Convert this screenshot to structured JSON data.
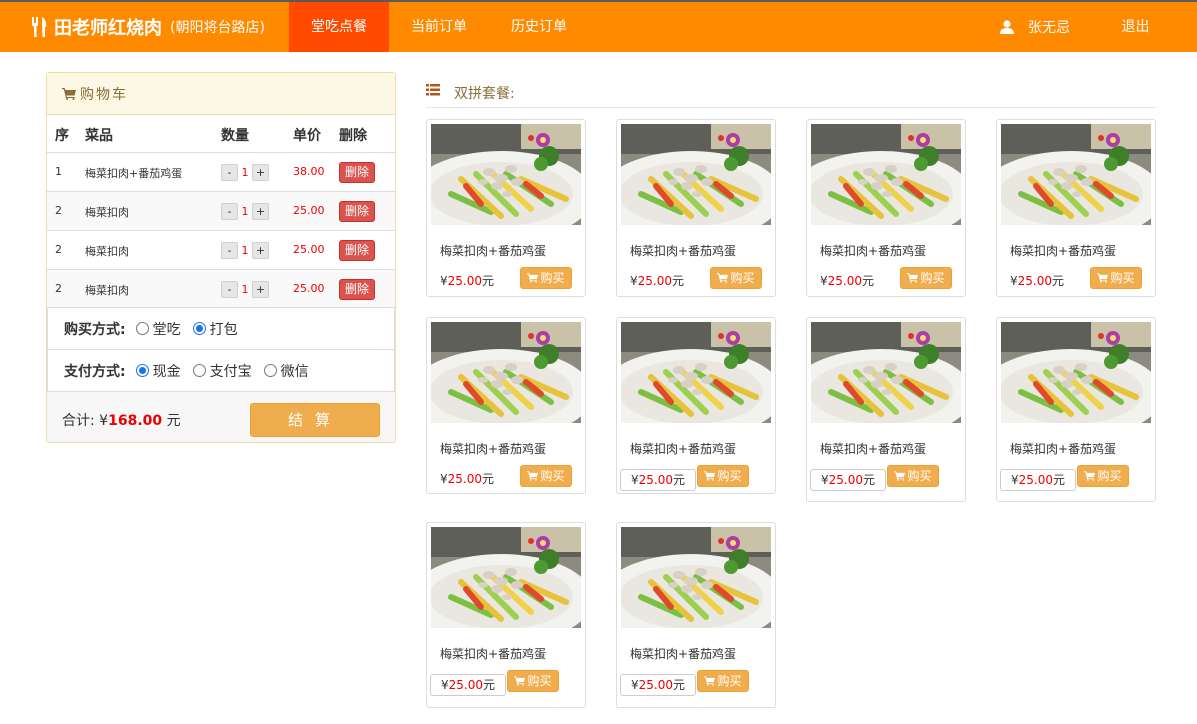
{
  "nav": {
    "brand_name": "田老师红烧肉",
    "brand_branch": "(朝阳将台路店)",
    "items": [
      "堂吃点餐",
      "当前订单",
      "历史订单"
    ],
    "user_name": "张无忌",
    "logout": "退出",
    "accent_color": "#ff8a00",
    "active_color": "#ff4a00"
  },
  "cart": {
    "title": "购物车",
    "headers": [
      "序",
      "菜品",
      "数量",
      "单价",
      "删除"
    ],
    "rows": [
      {
        "seq": "1",
        "name": "梅菜扣肉+番茄鸡蛋",
        "qty": "1",
        "price": "38.00",
        "del": "删除"
      },
      {
        "seq": "2",
        "name": "梅菜扣肉",
        "qty": "1",
        "price": "25.00",
        "del": "删除"
      },
      {
        "seq": "2",
        "name": "梅菜扣肉",
        "qty": "1",
        "price": "25.00",
        "del": "删除"
      },
      {
        "seq": "2",
        "name": "梅菜扣肉",
        "qty": "1",
        "price": "25.00",
        "del": "删除"
      }
    ],
    "minus": "-",
    "plus": "+",
    "purchase_label": "购买方式:",
    "purchase_options": [
      {
        "label": "堂吃",
        "checked": false
      },
      {
        "label": "打包",
        "checked": true
      }
    ],
    "payment_label": "支付方式:",
    "payment_options": [
      {
        "label": "现金",
        "checked": true
      },
      {
        "label": "支付宝",
        "checked": false
      },
      {
        "label": "微信",
        "checked": false
      }
    ],
    "total_label": "合计:",
    "currency": "¥",
    "total_amount": "168.00",
    "total_unit": "元",
    "checkout": "结算"
  },
  "menu": {
    "section_title": "双拼套餐:",
    "buy_label": "购买",
    "items": [
      {
        "name": "梅菜扣肉+番茄鸡蛋",
        "currency": "¥",
        "price": "25.00",
        "unit": "元"
      },
      {
        "name": "梅菜扣肉+番茄鸡蛋",
        "currency": "¥",
        "price": "25.00",
        "unit": "元"
      },
      {
        "name": "梅菜扣肉+番茄鸡蛋",
        "currency": "¥",
        "price": "25.00",
        "unit": "元"
      },
      {
        "name": "梅菜扣肉+番茄鸡蛋",
        "currency": "¥",
        "price": "25.00",
        "unit": "元"
      },
      {
        "name": "梅菜扣肉+番茄鸡蛋",
        "currency": "¥",
        "price": "25.00",
        "unit": "元"
      },
      {
        "name": "梅菜扣肉+番茄鸡蛋",
        "currency": "¥",
        "price": "25.00",
        "unit": "元"
      },
      {
        "name": "梅菜扣肉+番茄鸡蛋",
        "currency": "¥",
        "price": "25.00",
        "unit": "元"
      },
      {
        "name": "梅菜扣肉+番茄鸡蛋",
        "currency": "¥",
        "price": "25.00",
        "unit": "元"
      },
      {
        "name": "梅菜扣肉+番茄鸡蛋",
        "currency": "¥",
        "price": "25.00",
        "unit": "元"
      },
      {
        "name": "梅菜扣肉+番茄鸡蛋",
        "currency": "¥",
        "price": "25.00",
        "unit": "元"
      }
    ]
  }
}
